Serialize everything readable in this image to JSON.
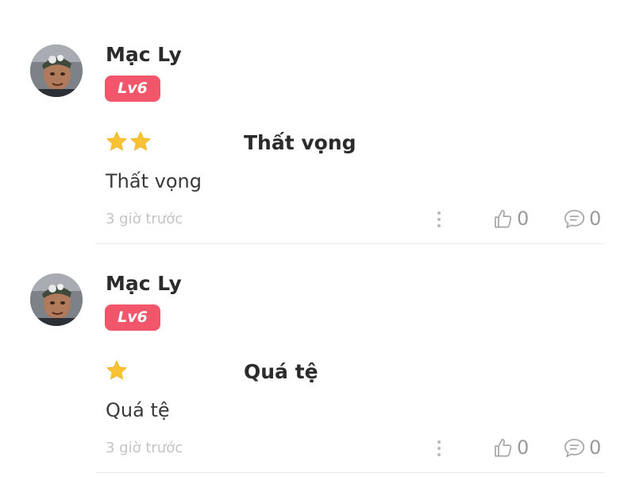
{
  "reviews": [
    {
      "username": "Mạc Ly",
      "level": "Lv6",
      "rating": 2,
      "title": "Thất vọng",
      "body": "Thất vọng",
      "time": "3 giờ trước",
      "likes": "0",
      "comments": "0"
    },
    {
      "username": "Mạc Ly",
      "level": "Lv6",
      "rating": 1,
      "title": "Quá tệ",
      "body": "Quá tệ",
      "time": "3 giờ trước",
      "likes": "0",
      "comments": "0"
    }
  ],
  "colors": {
    "badge": "#f1566b",
    "star": "#f7c236",
    "muted": "#9a9a9a",
    "divider": "#ececec"
  },
  "icons": {
    "star": "star-icon",
    "more": "more-vertical-icon",
    "like": "thumbs-up-icon",
    "comment": "comment-bubble-icon"
  }
}
